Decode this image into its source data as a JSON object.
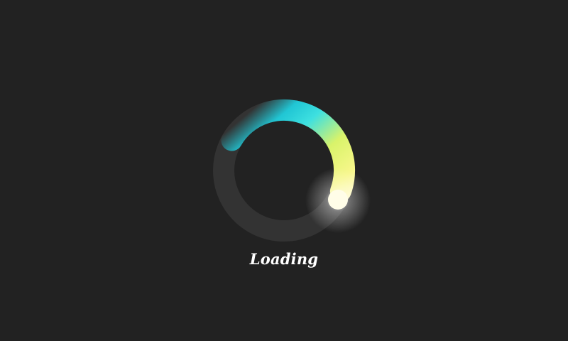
{
  "loader": {
    "label": "Loading",
    "colors": {
      "background": "#222222",
      "track": "#333333",
      "arc_start": "#1fd6e6",
      "arc_mid": "#d9f36a",
      "arc_end": "#fff9c4",
      "head_glow": "#ffffff"
    }
  }
}
